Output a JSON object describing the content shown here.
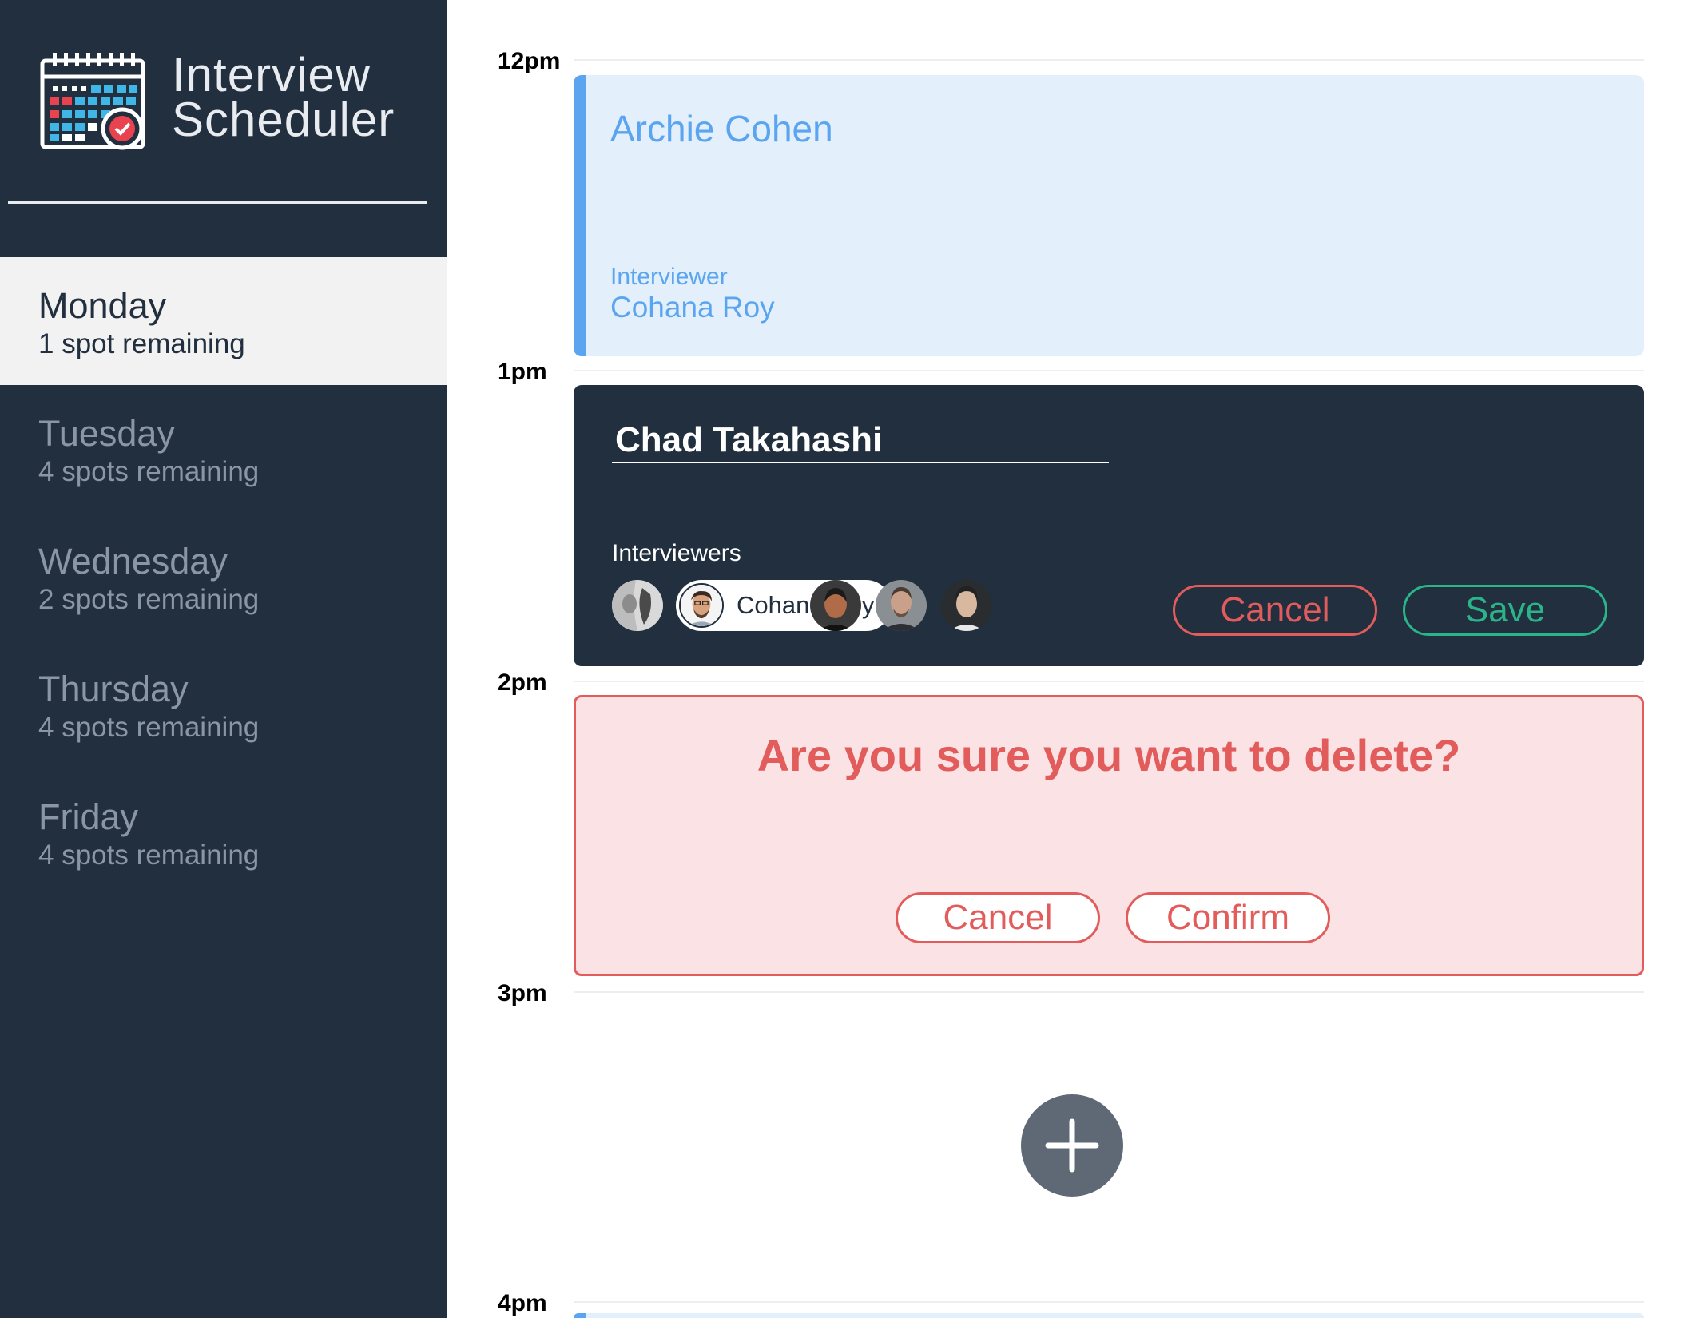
{
  "app": {
    "title_line1": "Interview",
    "title_line2": "Scheduler"
  },
  "days": [
    {
      "name": "Monday",
      "spots": "1 spot remaining",
      "selected": true
    },
    {
      "name": "Tuesday",
      "spots": "4 spots remaining"
    },
    {
      "name": "Wednesday",
      "spots": "2 spots remaining"
    },
    {
      "name": "Thursday",
      "spots": "4 spots remaining"
    },
    {
      "name": "Friday",
      "spots": "4 spots remaining"
    }
  ],
  "times": [
    "12pm",
    "1pm",
    "2pm",
    "3pm",
    "4pm"
  ],
  "appointment_show": {
    "student": "Archie Cohen",
    "interviewer_label": "Interviewer",
    "interviewer": "Cohana Roy"
  },
  "appointment_edit": {
    "student_value": "Chad Takahashi",
    "interviewers_label": "Interviewers",
    "selected_interviewer": "Cohana Roy",
    "cancel_label": "Cancel",
    "save_label": "Save"
  },
  "appointment_confirm": {
    "message": "Are you sure you want to delete?",
    "cancel_label": "Cancel",
    "confirm_label": "Confirm"
  },
  "add_button": {
    "icon": "plus-icon"
  },
  "colors": {
    "sidebar_bg": "#222f3e",
    "accent_blue": "#5ba5f0",
    "danger": "#e25c5c",
    "success": "#2bb38a"
  }
}
